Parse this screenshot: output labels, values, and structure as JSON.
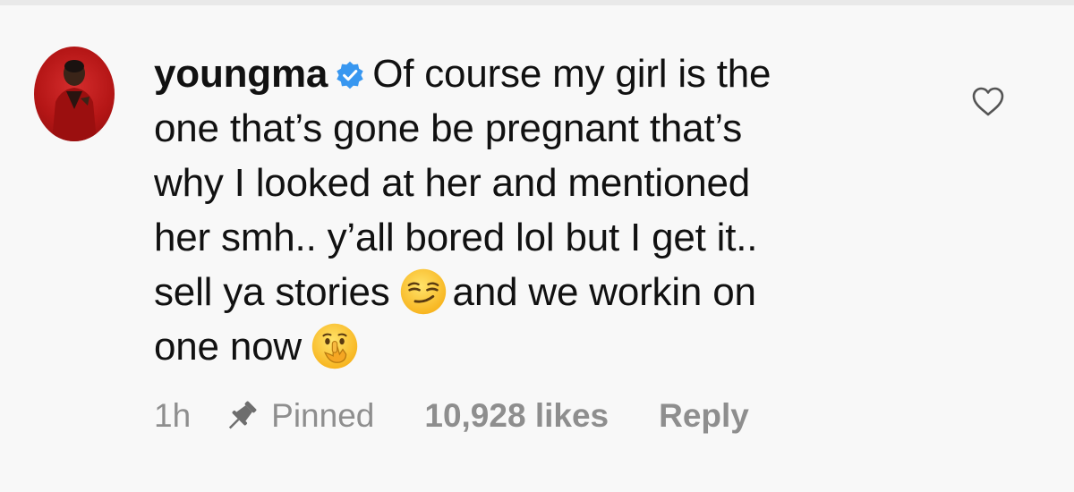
{
  "comment": {
    "username": "youngma",
    "verified": true,
    "text_line_1": "Of course my girl is the",
    "text_line_2": "one that’s gone be pregnant that’s",
    "text_line_3": "why I looked at her and mentioned",
    "text_line_4": "her smh.. y’all bored lol but I get it..",
    "text_line_5a": "sell ya stories",
    "text_line_5b": "and we workin on",
    "text_line_6": "one now",
    "emojis": [
      "smirking-face-emoji",
      "shushing-face-emoji"
    ]
  },
  "meta": {
    "time": "1h",
    "pinned_label": "Pinned",
    "likes": "10,928 likes",
    "reply_label": "Reply"
  },
  "icons": {
    "verified": "verified-badge-icon",
    "like": "heart-outline-icon",
    "pin": "pin-icon"
  },
  "colors": {
    "background": "#f8f8f8",
    "text": "#111111",
    "muted": "#8e8e8e",
    "verified": "#3897f0",
    "avatar_bg": "#b51616"
  }
}
